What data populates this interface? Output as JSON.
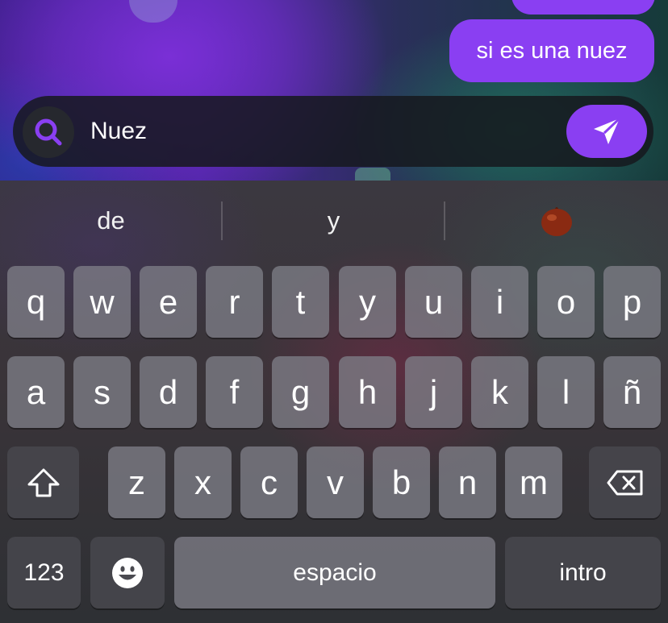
{
  "chat": {
    "messages": [
      {
        "text": "si es una nuez",
        "from": "me"
      }
    ]
  },
  "composer": {
    "search_icon": "search-icon",
    "value": "Nuez",
    "send_icon": "paper-plane-icon"
  },
  "keyboard": {
    "suggestions": [
      "de",
      "y"
    ],
    "emoji_suggestion_icon": "chestnut-icon",
    "row1": [
      "q",
      "w",
      "e",
      "r",
      "t",
      "y",
      "u",
      "i",
      "o",
      "p"
    ],
    "row2": [
      "a",
      "s",
      "d",
      "f",
      "g",
      "h",
      "j",
      "k",
      "l",
      "ñ"
    ],
    "row3": [
      "z",
      "x",
      "c",
      "v",
      "b",
      "n",
      "m"
    ],
    "numbers_label": "123",
    "space_label": "espacio",
    "return_label": "intro",
    "shift_icon": "shift-icon",
    "delete_icon": "backspace-icon",
    "emoji_icon": "emoji-icon"
  },
  "colors": {
    "accent": "#8a3ff2"
  }
}
